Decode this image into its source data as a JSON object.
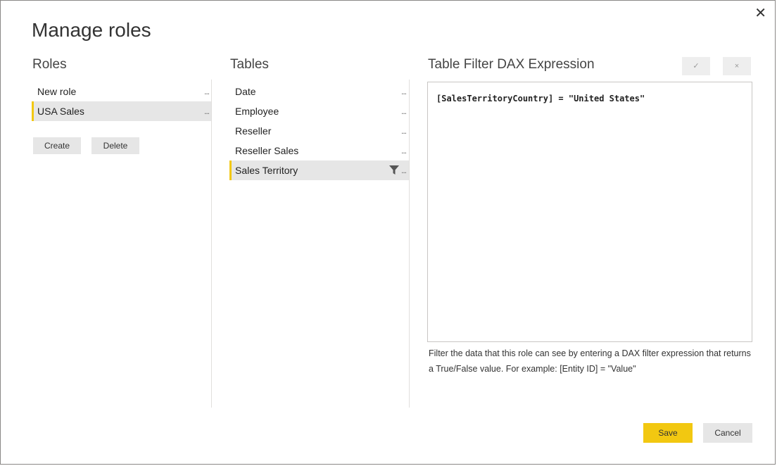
{
  "dialog": {
    "title": "Manage roles",
    "close_glyph": "✕"
  },
  "roles": {
    "header": "Roles",
    "items": [
      {
        "label": "New role",
        "more": "...",
        "selected": false
      },
      {
        "label": "USA Sales",
        "more": "...",
        "selected": true
      }
    ],
    "create_label": "Create",
    "delete_label": "Delete"
  },
  "tables": {
    "header": "Tables",
    "items": [
      {
        "label": "Date",
        "more": "...",
        "selected": false,
        "filtered": false
      },
      {
        "label": "Employee",
        "more": "...",
        "selected": false,
        "filtered": false
      },
      {
        "label": "Reseller",
        "more": "...",
        "selected": false,
        "filtered": false
      },
      {
        "label": "Reseller Sales",
        "more": "...",
        "selected": false,
        "filtered": false
      },
      {
        "label": "Sales Territory",
        "more": "...",
        "selected": true,
        "filtered": true
      }
    ]
  },
  "dax": {
    "header": "Table Filter DAX Expression",
    "accept_glyph": "✓",
    "discard_glyph": "×",
    "expression": "[SalesTerritoryCountry] = \"United States\"",
    "hint": "Filter the data that this role can see by entering a DAX filter expression that returns a True/False value. For example: [Entity ID] = \"Value\""
  },
  "footer": {
    "save_label": "Save",
    "cancel_label": "Cancel"
  },
  "colors": {
    "accent": "#f2c811",
    "selected_bg": "#e6e6e6"
  }
}
